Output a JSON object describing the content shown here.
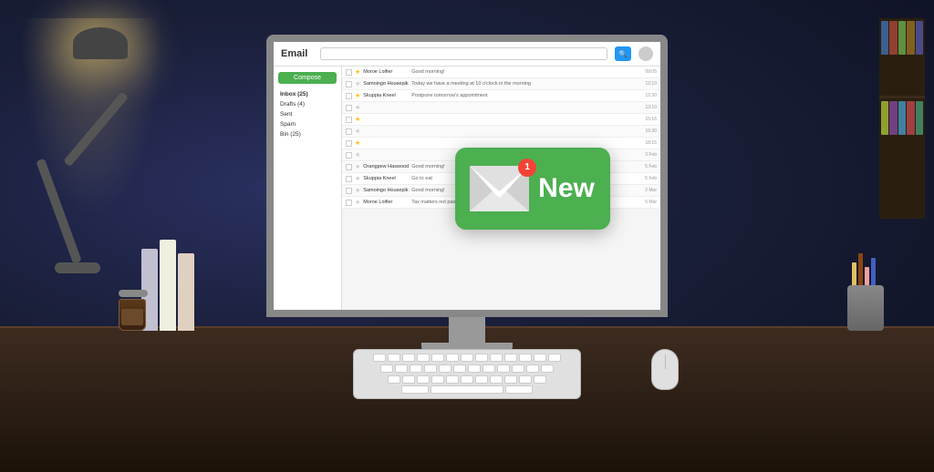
{
  "app": {
    "title": "Email",
    "search_placeholder": "",
    "compose_label": "Compose",
    "user_icon": "👤"
  },
  "sidebar": {
    "items": [
      {
        "label": "Inbox (25)",
        "id": "inbox",
        "active": true
      },
      {
        "label": "Drafts (4)",
        "id": "drafts"
      },
      {
        "label": "Sent",
        "id": "sent"
      },
      {
        "label": "Spam",
        "id": "spam"
      },
      {
        "label": "Bin (25)",
        "id": "bin"
      }
    ]
  },
  "emails": [
    {
      "sender": "Moroe Loifier",
      "subject": "Good morning!",
      "date": "09:05",
      "starred": true
    },
    {
      "sender": "Samoingo Housepik",
      "subject": "Today we have a meeting at 10 o'clock in the morning",
      "date": "12:10",
      "starred": false
    },
    {
      "sender": "Skuppia Kneel",
      "subject": "Postpone tomorrow's appointment",
      "date": "12:30",
      "starred": true
    },
    {
      "sender": "",
      "subject": "",
      "date": "13:10",
      "starred": false
    },
    {
      "sender": "",
      "subject": "",
      "date": "15:16",
      "starred": true
    },
    {
      "sender": "",
      "subject": "",
      "date": "16:30",
      "starred": false
    },
    {
      "sender": "",
      "subject": "",
      "date": "18:15",
      "starred": true
    },
    {
      "sender": "",
      "subject": "",
      "date": "3 Feb",
      "starred": false
    },
    {
      "sender": "Orangpew Haswood",
      "subject": "Good morning!",
      "date": "5 Feb",
      "starred": false
    },
    {
      "sender": "Skuppia Kneel",
      "subject": "Go to eat",
      "date": "5 Feb",
      "starred": false
    },
    {
      "sender": "Samoingo Housepik",
      "subject": "Good morning!",
      "date": "2 Mar",
      "starred": false
    },
    {
      "sender": "Moroe Loifier",
      "subject": "Tax matters not paid",
      "date": "5 Mar",
      "starred": false
    }
  ],
  "notification": {
    "badge_count": "1",
    "new_label": "New"
  },
  "colors": {
    "green": "#4caf50",
    "blue": "#2196f3",
    "red": "#f44336",
    "star": "#ffc107"
  }
}
